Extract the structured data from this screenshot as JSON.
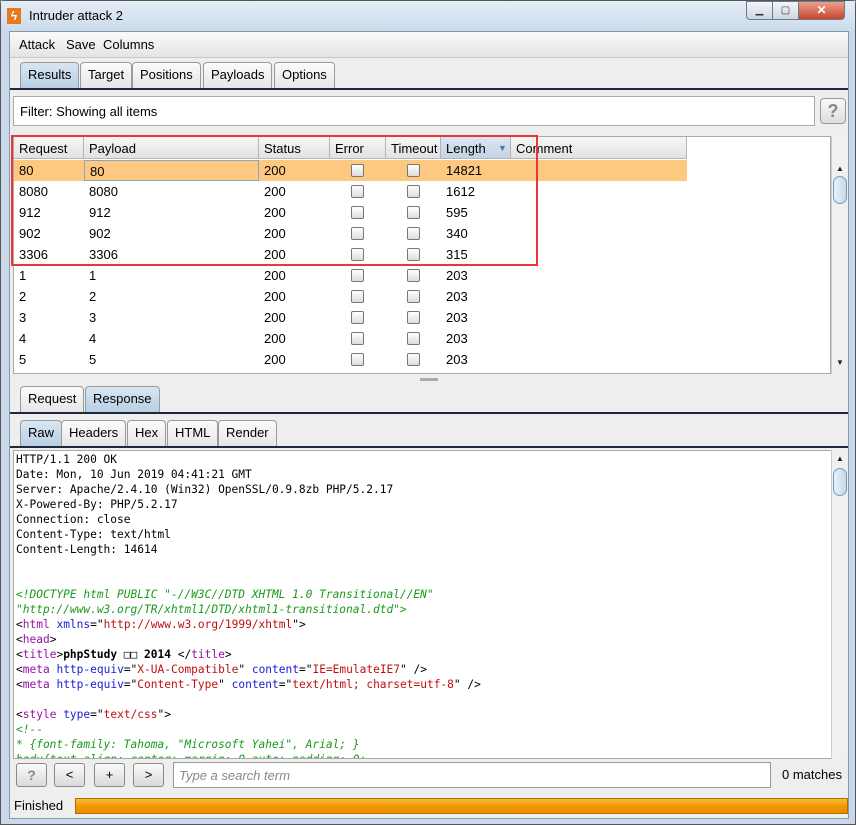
{
  "window": {
    "title": "Intruder attack 2",
    "app_icon": "burp-lightning-icon"
  },
  "menu": [
    "Attack",
    "Save",
    "Columns"
  ],
  "main_tabs": [
    {
      "label": "Results",
      "selected": true
    },
    {
      "label": "Target"
    },
    {
      "label": "Positions"
    },
    {
      "label": "Payloads"
    },
    {
      "label": "Options"
    }
  ],
  "filter": {
    "text": "Filter: Showing all items",
    "help": "?"
  },
  "table": {
    "columns": [
      "Request",
      "Payload",
      "Status",
      "Error",
      "Timeout",
      "Length",
      "Comment"
    ],
    "sorted_column": "Length",
    "sort_direction": "descending",
    "rows": [
      {
        "request": "80",
        "payload": "80",
        "status": "200",
        "error": false,
        "timeout": false,
        "length": "14821",
        "comment": "",
        "selected": true
      },
      {
        "request": "8080",
        "payload": "8080",
        "status": "200",
        "error": false,
        "timeout": false,
        "length": "1612",
        "comment": ""
      },
      {
        "request": "912",
        "payload": "912",
        "status": "200",
        "error": false,
        "timeout": false,
        "length": "595",
        "comment": ""
      },
      {
        "request": "902",
        "payload": "902",
        "status": "200",
        "error": false,
        "timeout": false,
        "length": "340",
        "comment": ""
      },
      {
        "request": "3306",
        "payload": "3306",
        "status": "200",
        "error": false,
        "timeout": false,
        "length": "315",
        "comment": ""
      },
      {
        "request": "1",
        "payload": "1",
        "status": "200",
        "error": false,
        "timeout": false,
        "length": "203",
        "comment": ""
      },
      {
        "request": "2",
        "payload": "2",
        "status": "200",
        "error": false,
        "timeout": false,
        "length": "203",
        "comment": ""
      },
      {
        "request": "3",
        "payload": "3",
        "status": "200",
        "error": false,
        "timeout": false,
        "length": "203",
        "comment": ""
      },
      {
        "request": "4",
        "payload": "4",
        "status": "200",
        "error": false,
        "timeout": false,
        "length": "203",
        "comment": ""
      },
      {
        "request": "5",
        "payload": "5",
        "status": "200",
        "error": false,
        "timeout": false,
        "length": "203",
        "comment": ""
      }
    ],
    "highlight_color": "#e8373a"
  },
  "detail_tabs": [
    {
      "label": "Request"
    },
    {
      "label": "Response",
      "selected": true
    }
  ],
  "view_tabs": [
    {
      "label": "Raw",
      "selected": true
    },
    {
      "label": "Headers"
    },
    {
      "label": "Hex"
    },
    {
      "label": "HTML"
    },
    {
      "label": "Render"
    }
  ],
  "response_lines": [
    [
      [
        "HTTP/1.1 200 OK",
        ""
      ]
    ],
    [
      [
        "Date: Mon, 10 Jun 2019 04:41:21 GMT",
        ""
      ]
    ],
    [
      [
        "Server: Apache/2.4.10 (Win32) OpenSSL/0.9.8zb PHP/5.2.17",
        ""
      ]
    ],
    [
      [
        "X-Powered-By: PHP/5.2.17",
        ""
      ]
    ],
    [
      [
        "Connection: close",
        ""
      ]
    ],
    [
      [
        "Content-Type: text/html",
        ""
      ]
    ],
    [
      [
        "Content-Length: 14614",
        ""
      ]
    ],
    [],
    [],
    [
      [
        "<!DOCTYPE html PUBLIC \"-//W3C//DTD XHTML 1.0 Transitional//EN\"",
        "com"
      ]
    ],
    [
      [
        "\"http://www.w3.org/TR/xhtml1/DTD/xhtml1-transitional.dtd\">",
        "com"
      ]
    ],
    [
      [
        "<",
        ""
      ],
      [
        "html",
        "tag"
      ],
      [
        " ",
        ""
      ],
      [
        "xmlns",
        "attr"
      ],
      [
        "=\"",
        ""
      ],
      [
        "http://www.w3.org/1999/xhtml",
        "val"
      ],
      [
        "\">",
        ""
      ]
    ],
    [
      [
        "<",
        ""
      ],
      [
        "head",
        "tag"
      ],
      [
        ">",
        ""
      ]
    ],
    [
      [
        "<",
        ""
      ],
      [
        "title",
        "tag"
      ],
      [
        ">",
        ""
      ],
      [
        "phpStudy □□ 2014",
        "bold"
      ],
      [
        " </",
        ""
      ],
      [
        "title",
        "tag"
      ],
      [
        ">",
        ""
      ]
    ],
    [
      [
        "<",
        ""
      ],
      [
        "meta",
        "tag"
      ],
      [
        " ",
        ""
      ],
      [
        "http-equiv",
        "attr"
      ],
      [
        "=\"",
        ""
      ],
      [
        "X-UA-Compatible",
        "val"
      ],
      [
        "\" ",
        ""
      ],
      [
        "content",
        "attr"
      ],
      [
        "=\"",
        ""
      ],
      [
        "IE=EmulateIE7",
        "val"
      ],
      [
        "\" />",
        ""
      ]
    ],
    [
      [
        "<",
        ""
      ],
      [
        "meta",
        "tag"
      ],
      [
        " ",
        ""
      ],
      [
        "http-equiv",
        "attr"
      ],
      [
        "=\"",
        ""
      ],
      [
        "Content-Type",
        "val"
      ],
      [
        "\" ",
        ""
      ],
      [
        "content",
        "attr"
      ],
      [
        "=\"",
        ""
      ],
      [
        "text/html; charset=utf-8",
        "val"
      ],
      [
        "\" />",
        ""
      ]
    ],
    [],
    [
      [
        "<",
        ""
      ],
      [
        "style",
        "tag"
      ],
      [
        " ",
        ""
      ],
      [
        "type",
        "attr"
      ],
      [
        "=\"",
        ""
      ],
      [
        "text/css",
        "val"
      ],
      [
        "\">",
        ""
      ]
    ],
    [
      [
        "<!--",
        "com"
      ]
    ],
    [
      [
        "* {font-family: Tahoma, \"Microsoft Yahei\", Arial; }",
        "com"
      ]
    ],
    [
      [
        "body{text-align: center; margin: 0 auto; padding: 0;",
        "com"
      ]
    ]
  ],
  "search": {
    "help": "?",
    "prev": "<",
    "add": "+",
    "next": ">",
    "placeholder": "Type a search term",
    "matches": "0 matches"
  },
  "status": {
    "text": "Finished",
    "progress": 1.0
  }
}
